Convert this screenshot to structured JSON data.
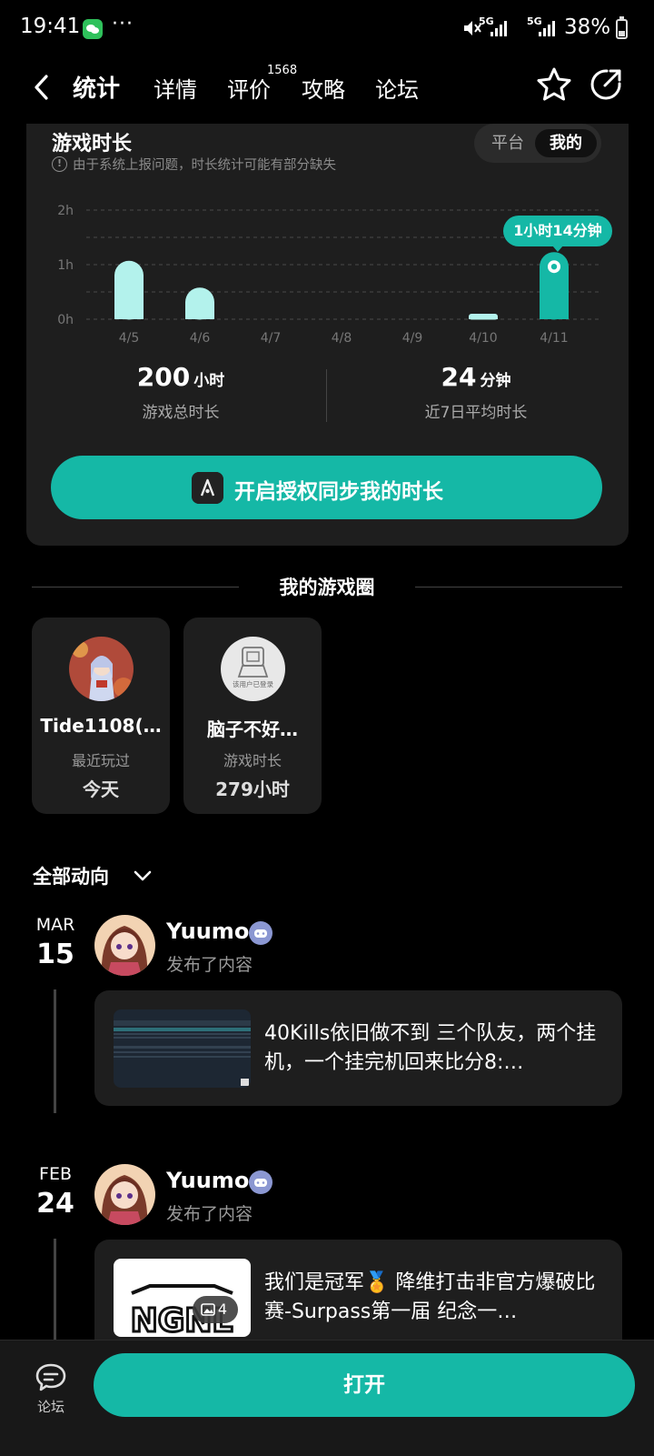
{
  "status_bar": {
    "time": "19:41",
    "more": "···",
    "network_1": "5G",
    "network_2": "5G",
    "battery": "38%"
  },
  "nav": {
    "tabs": [
      {
        "label": "统计",
        "active": true
      },
      {
        "label": "详情"
      },
      {
        "label": "评价",
        "badge": "1568"
      },
      {
        "label": "攻略"
      },
      {
        "label": "论坛"
      }
    ]
  },
  "stats": {
    "title": "游戏时长",
    "note": "由于系统上报问题，时长统计可能有部分缺失",
    "toggle": {
      "platform": "平台",
      "mine": "我的"
    },
    "total": {
      "value": "200",
      "unit": "小时",
      "label": "游戏总时长"
    },
    "average": {
      "value": "24",
      "unit": "分钟",
      "label": "近7日平均时长"
    },
    "sync_button": "开启授权同步我的时长"
  },
  "chart_data": {
    "type": "bar",
    "categories": [
      "4/5",
      "4/6",
      "4/7",
      "4/8",
      "4/9",
      "4/10",
      "4/11"
    ],
    "values": [
      1.07,
      0.58,
      0,
      0,
      0,
      0.1,
      1.23
    ],
    "y_ticks": [
      "0h",
      "1h",
      "2h"
    ],
    "ylim": [
      0,
      2
    ],
    "grid": true,
    "highlight": {
      "index": 6,
      "label": "1小时14分钟"
    },
    "colors": {
      "bar": "#b3f2ec",
      "highlight": "#15b8a6"
    }
  },
  "game_circle": {
    "title": "我的游戏圈",
    "cards": [
      {
        "name": "Tide1108(…",
        "sub": "最近玩过",
        "value": "今天"
      },
      {
        "name": "脑子不好…",
        "sub": "游戏时长",
        "value": "279小时",
        "avatar_caption": "该用户已登录"
      }
    ]
  },
  "feed": {
    "filter": "全部动向",
    "items": [
      {
        "month": "MAR",
        "day": "15",
        "user": "Yuumo",
        "action": "发布了内容",
        "text": "40Kills依旧做不到 三个队友，两个挂机，一个挂完机回来比分8:…"
      },
      {
        "month": "FEB",
        "day": "24",
        "user": "Yuumo",
        "action": "发布了内容",
        "text": "我们是冠军🏅 降维打击非官方爆破比赛-Surpass第一届  纪念一…",
        "image_count": "4",
        "thumb_text": "NGNL"
      }
    ]
  },
  "bottom_bar": {
    "forum_label": "论坛",
    "open_button": "打开"
  }
}
